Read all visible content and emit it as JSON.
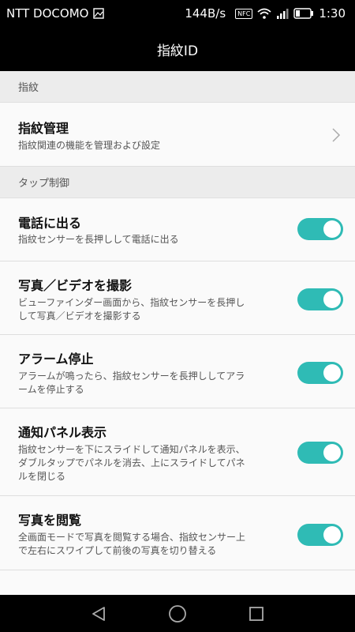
{
  "status_bar": {
    "carrier": "NTT DOCOMO",
    "speed": "144B/s",
    "nfc": "NFC",
    "time": "1:30"
  },
  "title_bar": {
    "title": "指紋ID"
  },
  "sections": {
    "fingerprint": {
      "label": "指紋"
    },
    "tap_control": {
      "label": "タップ制御"
    }
  },
  "manage": {
    "title": "指紋管理",
    "desc": "指紋関連の機能を管理および設定"
  },
  "items": [
    {
      "title": "電話に出る",
      "desc_lines": [
        "指紋センサーを長押しして電話に出る"
      ],
      "enabled": true
    },
    {
      "title": "写真／ビデオを撮影",
      "desc_lines": [
        "ビューファインダー画面から、指紋センサーを長押し",
        "して写真／ビデオを撮影する"
      ],
      "enabled": true
    },
    {
      "title": "アラーム停止",
      "desc_lines": [
        "アラームが鳴ったら、指紋センサーを長押ししてアラ",
        "ームを停止する"
      ],
      "enabled": true
    },
    {
      "title": "通知パネル表示",
      "desc_lines": [
        "指紋センサーを下にスライドして通知パネルを表示、",
        "ダブルタップでパネルを消去、上にスライドしてパネ",
        "ルを閉じる"
      ],
      "enabled": true
    },
    {
      "title": "写真を閲覧",
      "desc_lines": [
        "全画面モードで写真を閲覧する場合、指紋センサー上",
        "で左右にスワイプして前後の写真を切り替える"
      ],
      "enabled": true
    }
  ],
  "colors": {
    "accent": "#2fbbb5",
    "status_bar_bg": "#000000",
    "section_bg": "#ececec"
  },
  "nav": {
    "icons": [
      "back-icon",
      "home-icon",
      "recents-icon"
    ]
  }
}
